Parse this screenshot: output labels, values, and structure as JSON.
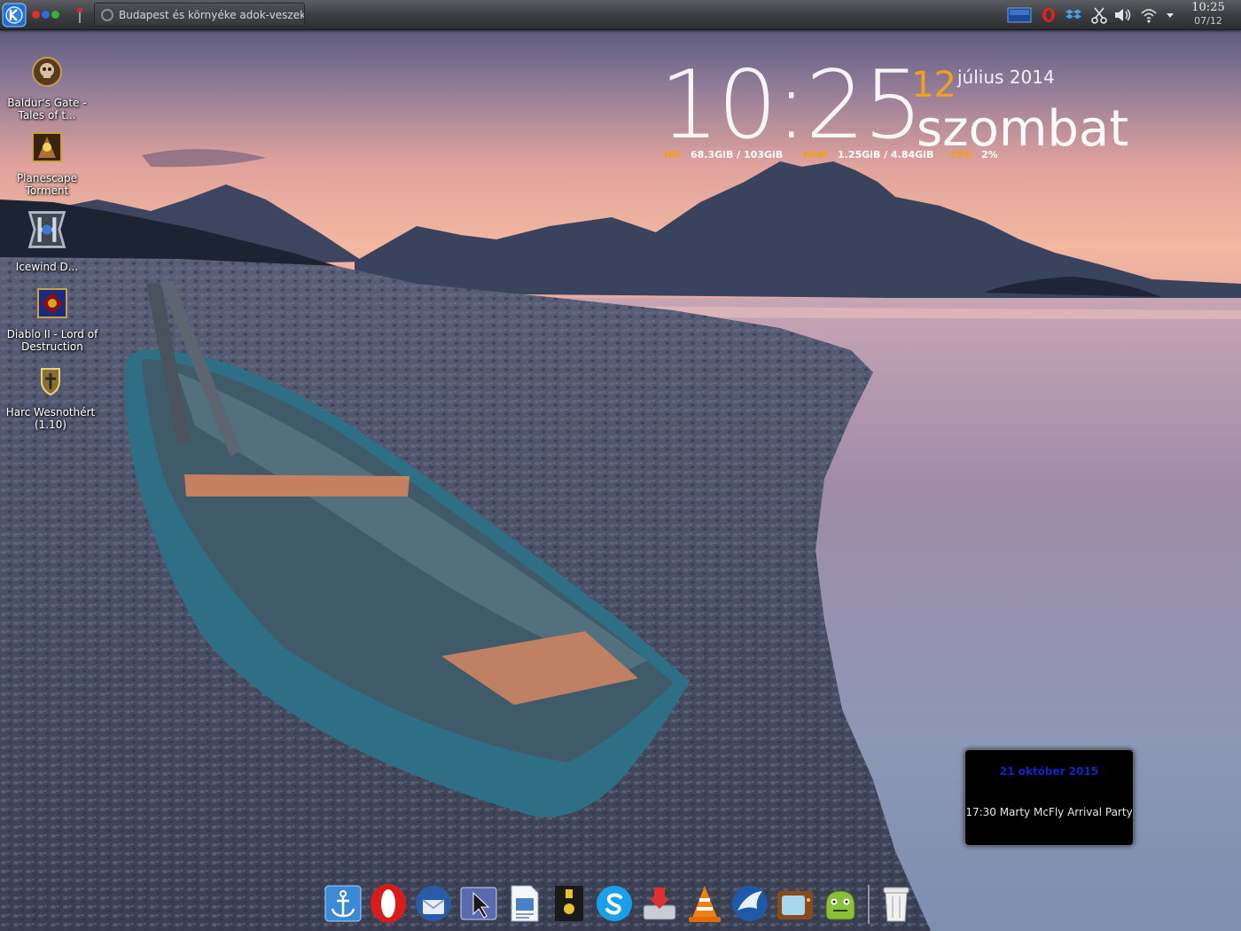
{
  "panel": {
    "task_title": "Budapest és környéke adok-veszek-b",
    "clock_time": "10:25",
    "clock_date": "07/12",
    "tray_icons": [
      "display-icon",
      "opera-tray-icon",
      "dropbox-icon",
      "scissors-icon",
      "volume-icon",
      "wifi-icon",
      "expand-tray-icon"
    ]
  },
  "desktop_icons": [
    {
      "label": "Baldur's Gate - Tales of t...",
      "icon": "baldurs-gate-icon"
    },
    {
      "label": "Planescape Torment",
      "icon": "planescape-icon"
    },
    {
      "label": "Icewind D...",
      "icon": "icewind-dale-icon"
    },
    {
      "label": "Diablo II - Lord of Destruction",
      "icon": "diablo-icon"
    },
    {
      "label": "Harc Wesnothért (1.10)",
      "icon": "wesnoth-icon"
    }
  ],
  "clock_widget": {
    "time": "10:25",
    "day": "12",
    "month_year": "július 2014",
    "weekday": "szombat"
  },
  "system_monitor": {
    "hd_label": "HD",
    "hd_value": "68.3GiB / 103GiB",
    "ram_label": "RAM",
    "ram_value": "1.25GiB / 4.84GiB",
    "cpu_label": "CPU",
    "cpu_value": "2%"
  },
  "event_widget": {
    "date": "21 október 2015",
    "text": "17:30 Marty McFly Arrival Party"
  },
  "dock": [
    "anchor-icon",
    "opera-icon",
    "thunderbird-icon",
    "screenshot-icon",
    "document-viewer-icon",
    "usb-icon",
    "skype-icon",
    "download-manager-icon",
    "vlc-icon",
    "browser-icon",
    "tv-icon",
    "android-icon",
    "trash-icon"
  ],
  "colors": {
    "accent": "#f0a020",
    "event_date": "#0a28c8",
    "panel": "#3a3c40"
  }
}
